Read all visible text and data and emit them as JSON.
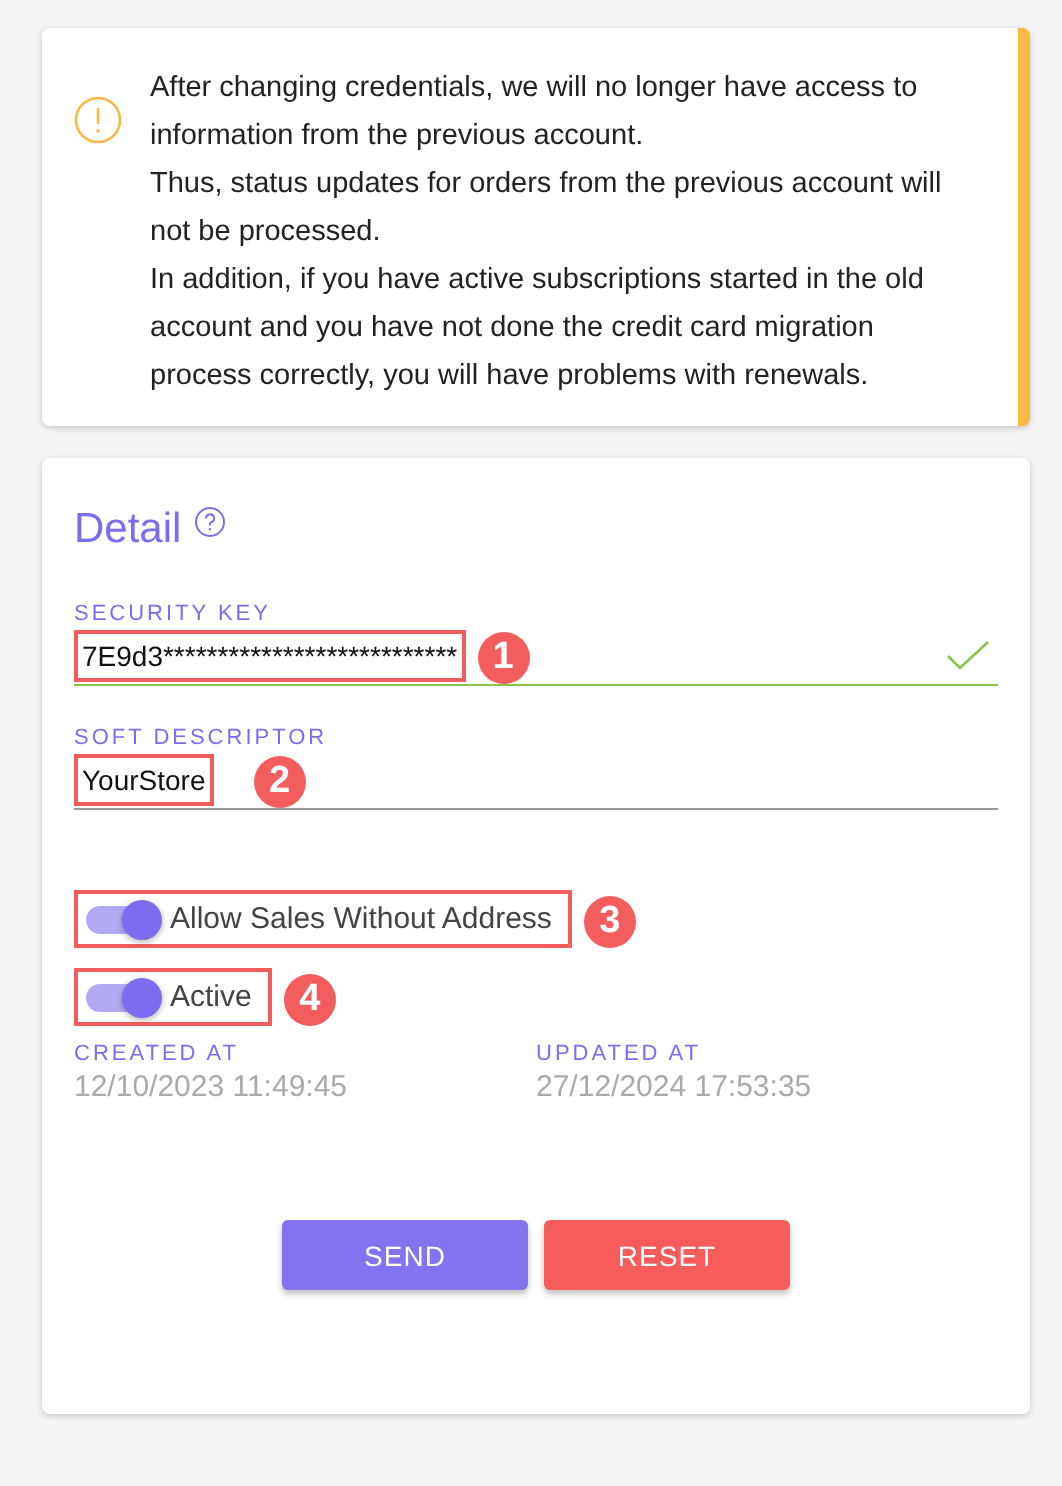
{
  "warning": {
    "lines": [
      "After changing credentials, we will no longer have access to information from the previous account.",
      "Thus, status updates for orders from the previous account will not be processed.",
      "In addition, if you have active subscriptions started in the old account and you have not done the credit card migration process correctly, you will have problems with renewals."
    ]
  },
  "detail": {
    "title": "Detail",
    "fields": [
      {
        "label": "SECURITY KEY",
        "value": "7E9d3***************************",
        "valid": true,
        "callout": "1"
      },
      {
        "label": "SOFT DESCRIPTOR",
        "value": "YourStore",
        "valid": false,
        "callout": "2"
      }
    ],
    "toggles": [
      {
        "label": "Allow Sales Without Address",
        "on": true,
        "callout": "3"
      },
      {
        "label": "Active",
        "on": true,
        "callout": "4"
      }
    ],
    "timestamps": [
      {
        "label": "CREATED AT",
        "value": "12/10/2023 11:49:45"
      },
      {
        "label": "UPDATED AT",
        "value": "27/12/2024 17:53:35"
      }
    ],
    "buttons": [
      {
        "label": "SEND",
        "kind": "primary"
      },
      {
        "label": "RESET",
        "kind": "danger"
      }
    ]
  }
}
